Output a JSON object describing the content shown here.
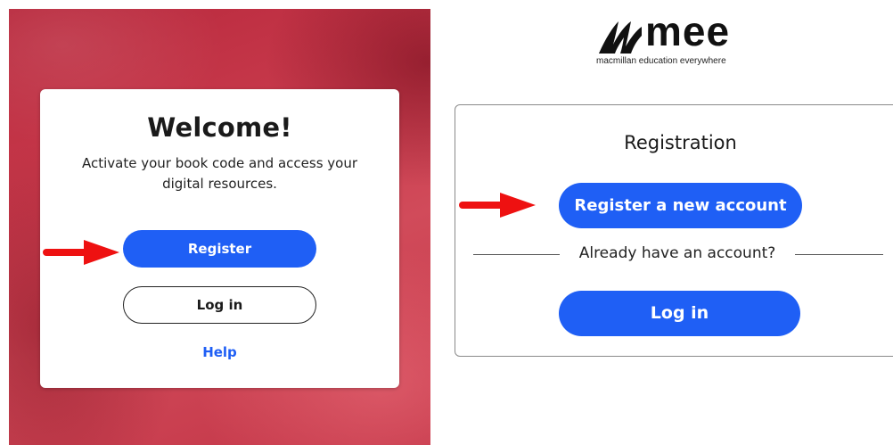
{
  "welcome_panel": {
    "title": "Welcome!",
    "description": "Activate your book code and access your digital resources.",
    "register_label": "Register",
    "login_label": "Log in",
    "help_label": "Help"
  },
  "brand": {
    "wordmark": "mee",
    "tagline": "macmillan education everywhere",
    "icon": "mee-logo-mark"
  },
  "registration_panel": {
    "title": "Registration",
    "register_label": "Register a new account",
    "divider_text": "Already have an account?",
    "login_label": "Log in"
  },
  "annotations": {
    "arrow_icon": "red-arrow-icon",
    "arrow_color": "#ee1111"
  },
  "colors": {
    "primary": "#1f5ff5",
    "background_red": "#c83a4c"
  }
}
